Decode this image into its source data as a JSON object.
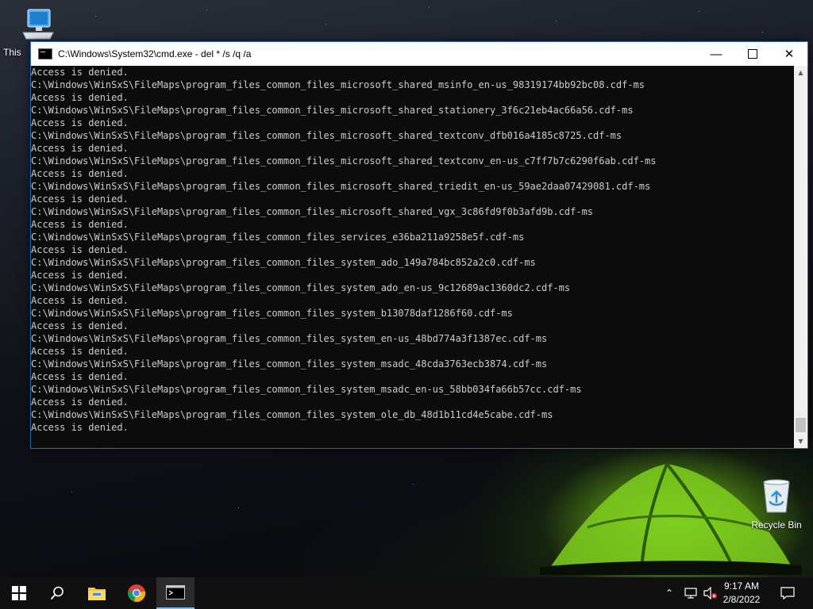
{
  "desktop": {
    "icons": {
      "this_pc": "This",
      "recycle_bin": "Recycle Bin"
    }
  },
  "window": {
    "title": "C:\\Windows\\System32\\cmd.exe - del  * /s /q /a",
    "console_lines": [
      "Access is denied.",
      "C:\\Windows\\WinSxS\\FileMaps\\program_files_common_files_microsoft_shared_msinfo_en-us_98319174bb92bc08.cdf-ms",
      "Access is denied.",
      "C:\\Windows\\WinSxS\\FileMaps\\program_files_common_files_microsoft_shared_stationery_3f6c21eb4ac66a56.cdf-ms",
      "Access is denied.",
      "C:\\Windows\\WinSxS\\FileMaps\\program_files_common_files_microsoft_shared_textconv_dfb016a4185c8725.cdf-ms",
      "Access is denied.",
      "C:\\Windows\\WinSxS\\FileMaps\\program_files_common_files_microsoft_shared_textconv_en-us_c7ff7b7c6290f6ab.cdf-ms",
      "Access is denied.",
      "C:\\Windows\\WinSxS\\FileMaps\\program_files_common_files_microsoft_shared_triedit_en-us_59ae2daa07429081.cdf-ms",
      "Access is denied.",
      "C:\\Windows\\WinSxS\\FileMaps\\program_files_common_files_microsoft_shared_vgx_3c86fd9f0b3afd9b.cdf-ms",
      "Access is denied.",
      "C:\\Windows\\WinSxS\\FileMaps\\program_files_common_files_services_e36ba211a9258e5f.cdf-ms",
      "Access is denied.",
      "C:\\Windows\\WinSxS\\FileMaps\\program_files_common_files_system_ado_149a784bc852a2c0.cdf-ms",
      "Access is denied.",
      "C:\\Windows\\WinSxS\\FileMaps\\program_files_common_files_system_ado_en-us_9c12689ac1360dc2.cdf-ms",
      "Access is denied.",
      "C:\\Windows\\WinSxS\\FileMaps\\program_files_common_files_system_b13078daf1286f60.cdf-ms",
      "Access is denied.",
      "C:\\Windows\\WinSxS\\FileMaps\\program_files_common_files_system_en-us_48bd774a3f1387ec.cdf-ms",
      "Access is denied.",
      "C:\\Windows\\WinSxS\\FileMaps\\program_files_common_files_system_msadc_48cda3763ecb3874.cdf-ms",
      "Access is denied.",
      "C:\\Windows\\WinSxS\\FileMaps\\program_files_common_files_system_msadc_en-us_58bb034fa66b57cc.cdf-ms",
      "Access is denied.",
      "C:\\Windows\\WinSxS\\FileMaps\\program_files_common_files_system_ole_db_48d1b11cd4e5cabe.cdf-ms",
      "Access is denied."
    ]
  },
  "taskbar": {
    "clock_time": "9:17 AM",
    "clock_date": "2/8/2022",
    "icons": [
      "windows-start-icon",
      "search-icon",
      "file-explorer-icon",
      "chrome-icon",
      "command-prompt-icon"
    ],
    "tray_icons": [
      "chevron-up-icon",
      "network-icon",
      "volume-muted-icon",
      "notification-icon"
    ]
  },
  "colors": {
    "console_bg": "#0c0c0c",
    "console_text": "#cccccc",
    "taskbar_bg": "#101010",
    "accent": "#76b9ed"
  }
}
